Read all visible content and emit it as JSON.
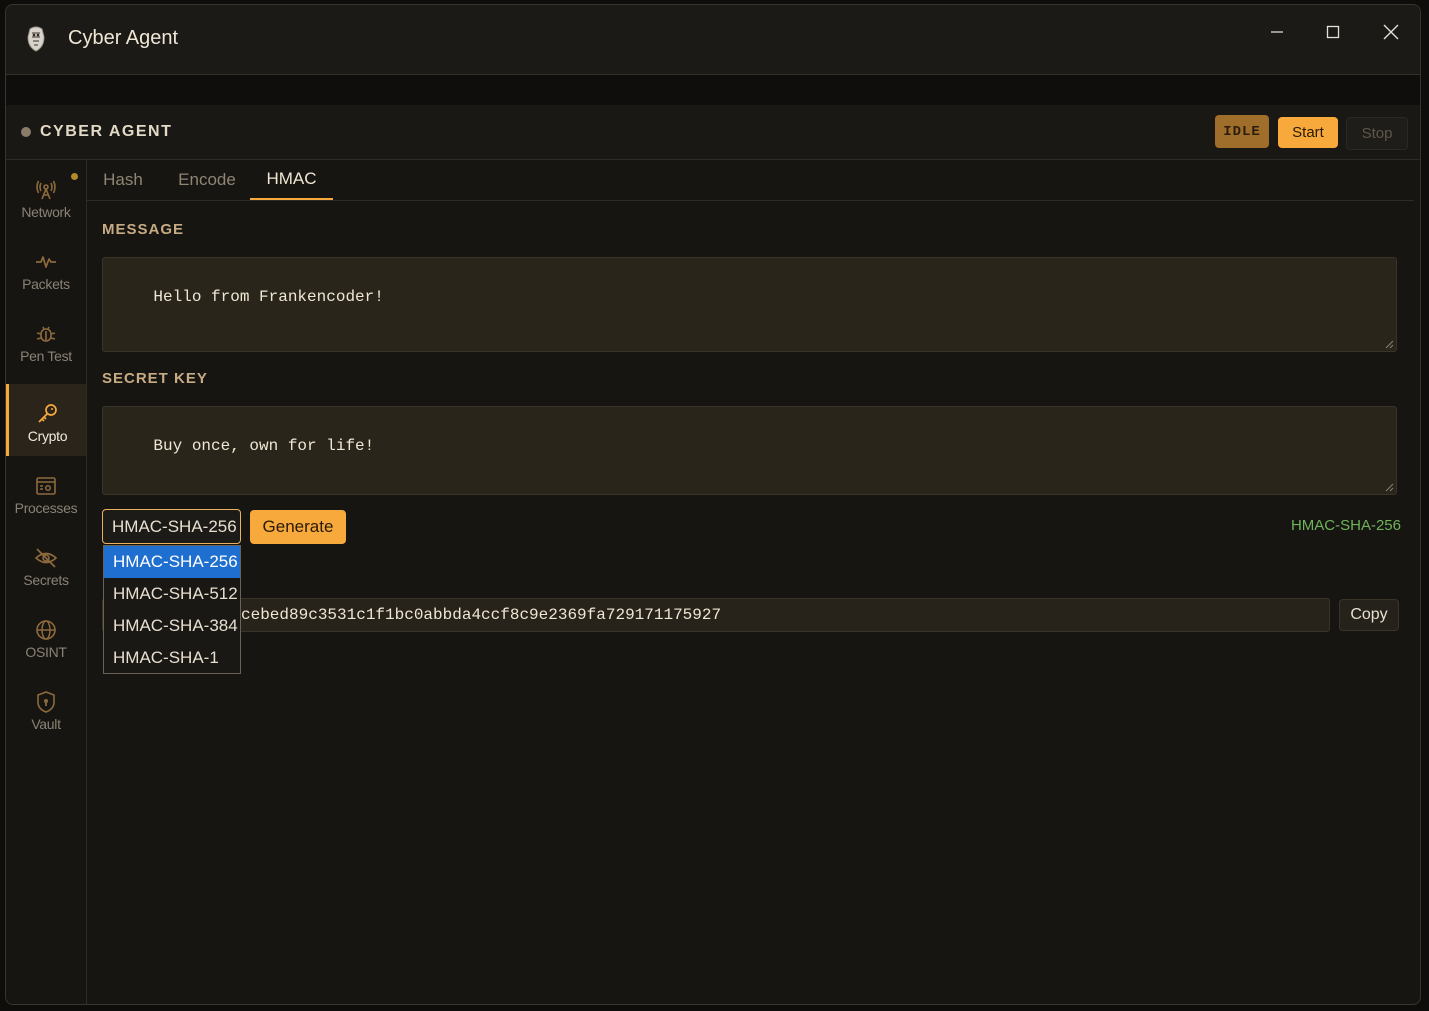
{
  "window": {
    "title": "Cyber Agent",
    "controls": {
      "minimize": "minimize-icon",
      "maximize": "maximize-icon",
      "close": "close-icon"
    }
  },
  "header": {
    "brand": "CYBER AGENT",
    "status": "IDLE",
    "start_label": "Start",
    "stop_label": "Stop"
  },
  "sidebar": {
    "items": [
      {
        "label": "Network",
        "icon": "antenna-icon"
      },
      {
        "label": "Packets",
        "icon": "pulse-icon"
      },
      {
        "label": "Pen Test",
        "icon": "bug-icon"
      },
      {
        "label": "Crypto",
        "icon": "key-icon"
      },
      {
        "label": "Processes",
        "icon": "process-window-icon"
      },
      {
        "label": "Secrets",
        "icon": "eye-off-icon"
      },
      {
        "label": "OSINT",
        "icon": "globe-icon"
      },
      {
        "label": "Vault",
        "icon": "shield-icon"
      }
    ],
    "active": "Crypto"
  },
  "tabs": [
    {
      "label": "Hash"
    },
    {
      "label": "Encode"
    },
    {
      "label": "HMAC"
    }
  ],
  "hmac": {
    "message_label": "MESSAGE",
    "message_value": "Hello from Frankencoder!",
    "secret_label": "SECRET KEY",
    "secret_value": "Buy once, own for life!",
    "algorithm_selected": "HMAC-SHA-256",
    "algorithm_options": [
      "HMAC-SHA-256",
      "HMAC-SHA-512",
      "HMAC-SHA-384",
      "HMAC-SHA-1"
    ],
    "generate_label": "Generate",
    "result_algorithm": "HMAC-SHA-256",
    "output_visible": "cebed89c3531c1f1bc0abbda4ccf8c9e2369fa729171175927",
    "copy_label": "Copy"
  },
  "colors": {
    "accent": "#f7a93c",
    "background": "#171511",
    "success_text": "#6fb35a",
    "dropdown_highlight": "#1f6fd0"
  }
}
